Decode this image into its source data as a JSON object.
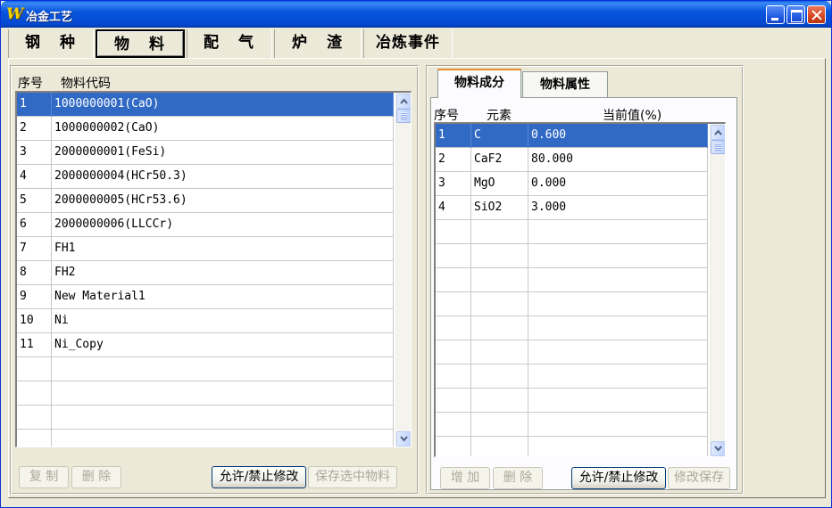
{
  "window": {
    "title": "冶金工艺",
    "icon": "app-logo-icon"
  },
  "main_tabs": [
    {
      "label": "钢 种",
      "active": false
    },
    {
      "label": "物 料",
      "active": true
    },
    {
      "label": "配 气",
      "active": false
    },
    {
      "label": "炉 渣",
      "active": false
    },
    {
      "label": "冶炼事件",
      "active": false
    }
  ],
  "materials": {
    "headers": {
      "index": "序号",
      "code": "物料代码"
    },
    "rows": [
      {
        "index": "1",
        "code": "1000000001(CaO)",
        "selected": true
      },
      {
        "index": "2",
        "code": "1000000002(CaO)"
      },
      {
        "index": "3",
        "code": "2000000001(FeSi)"
      },
      {
        "index": "4",
        "code": "2000000004(HCr50.3)"
      },
      {
        "index": "5",
        "code": "2000000005(HCr53.6)"
      },
      {
        "index": "6",
        "code": "2000000006(LLCCr)"
      },
      {
        "index": "7",
        "code": "FH1"
      },
      {
        "index": "8",
        "code": "FH2"
      },
      {
        "index": "9",
        "code": "New Material1"
      },
      {
        "index": "10",
        "code": "Ni"
      },
      {
        "index": "11",
        "code": "Ni_Copy"
      },
      {
        "index": "",
        "code": ""
      },
      {
        "index": "",
        "code": ""
      },
      {
        "index": "",
        "code": ""
      },
      {
        "index": "",
        "code": ""
      }
    ],
    "buttons": {
      "copy": "复 制",
      "delete": "删 除",
      "toggle_edit": "允许/禁止修改",
      "save_selected": "保存选中物料"
    }
  },
  "sub_tabs": [
    {
      "label": "物料成分",
      "active": true
    },
    {
      "label": "物料属性",
      "active": false
    }
  ],
  "composition": {
    "headers": {
      "index": "序号",
      "element": "元素",
      "value": "当前值(%)"
    },
    "rows": [
      {
        "index": "1",
        "element": "C",
        "value": "0.600",
        "selected": true
      },
      {
        "index": "2",
        "element": "CaF2",
        "value": "80.000"
      },
      {
        "index": "3",
        "element": "MgO",
        "value": "0.000"
      },
      {
        "index": "4",
        "element": "SiO2",
        "value": "3.000"
      },
      {
        "index": "",
        "element": "",
        "value": ""
      },
      {
        "index": "",
        "element": "",
        "value": ""
      },
      {
        "index": "",
        "element": "",
        "value": ""
      },
      {
        "index": "",
        "element": "",
        "value": ""
      },
      {
        "index": "",
        "element": "",
        "value": ""
      },
      {
        "index": "",
        "element": "",
        "value": ""
      },
      {
        "index": "",
        "element": "",
        "value": ""
      },
      {
        "index": "",
        "element": "",
        "value": ""
      },
      {
        "index": "",
        "element": "",
        "value": ""
      },
      {
        "index": "",
        "element": "",
        "value": ""
      }
    ],
    "buttons": {
      "add": "增 加",
      "delete": "删 除",
      "toggle_edit": "允许/禁止修改",
      "save_changes": "修改保存"
    }
  },
  "colors": {
    "selection": "#316ac5",
    "titlebar": "#0855dd",
    "face": "#ece9d8",
    "active_subtab_accent": "#e68b2c"
  }
}
